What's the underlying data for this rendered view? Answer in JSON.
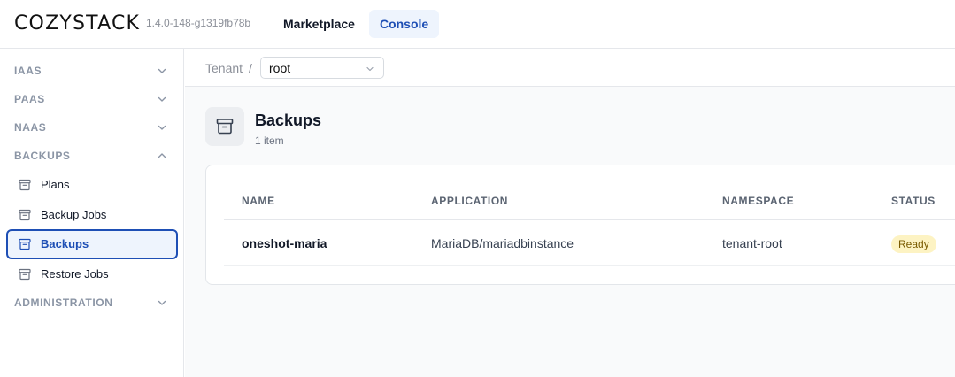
{
  "header": {
    "logo": "COZYSTACK",
    "version": "1.4.0-148-g1319fb78b",
    "tabs": [
      {
        "label": "Marketplace",
        "active": false
      },
      {
        "label": "Console",
        "active": true
      }
    ]
  },
  "sidebar": {
    "sections": [
      {
        "label": "IAAS",
        "expanded": false
      },
      {
        "label": "PAAS",
        "expanded": false
      },
      {
        "label": "NAAS",
        "expanded": false
      },
      {
        "label": "BACKUPS",
        "expanded": true
      },
      {
        "label": "ADMINISTRATION",
        "expanded": false
      }
    ],
    "backup_items": [
      {
        "label": "Plans",
        "icon": "archive-icon"
      },
      {
        "label": "Backup Jobs",
        "icon": "archive-icon"
      },
      {
        "label": "Backups",
        "icon": "archive-icon",
        "active": true
      },
      {
        "label": "Restore Jobs",
        "icon": "archive-icon"
      }
    ]
  },
  "breadcrumb": {
    "tenant_label": "Tenant",
    "separator": "/",
    "tenant_value": "root"
  },
  "page": {
    "title": "Backups",
    "subtitle": "1 item",
    "icon": "archive-icon"
  },
  "table": {
    "columns": [
      "NAME",
      "APPLICATION",
      "NAMESPACE",
      "STATUS"
    ],
    "rows": [
      {
        "name": "oneshot-maria",
        "application": "MariaDB/mariadbinstance",
        "namespace": "tenant-root",
        "status": "Ready"
      }
    ]
  },
  "colors": {
    "accent": "#1e4fb5",
    "accent_bg": "#eef4fd",
    "status_ready_bg": "#fdf3c3",
    "status_ready_fg": "#7a5b00"
  }
}
